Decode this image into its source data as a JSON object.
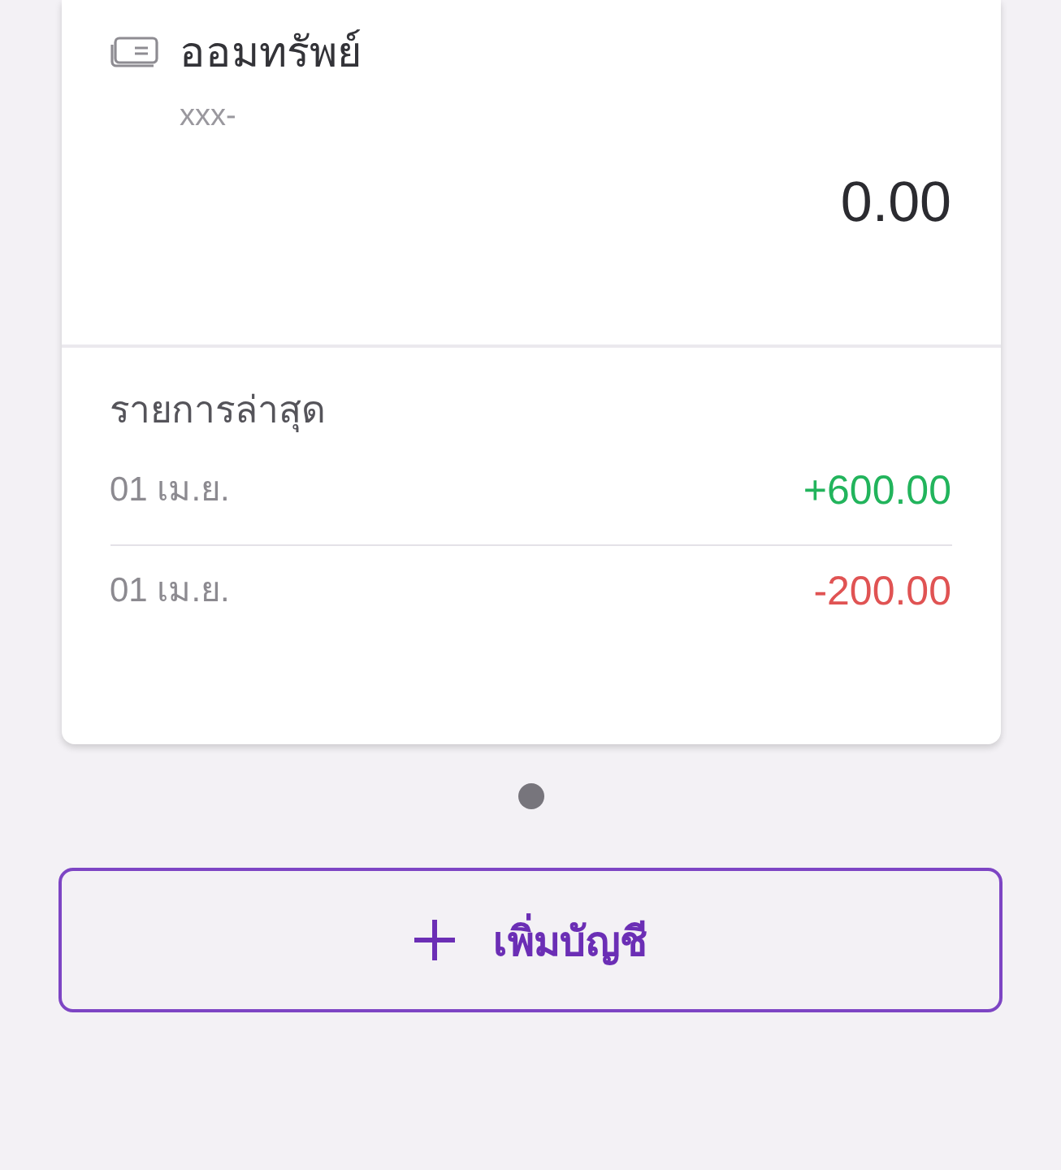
{
  "account": {
    "name": "ออมทรัพย์",
    "number": "xxx-",
    "balance": "0.00"
  },
  "recent": {
    "title": "รายการล่าสุด",
    "transactions": [
      {
        "date": "01 เม.ย.",
        "amount": "+600.00",
        "color": "#22b45c"
      },
      {
        "date": "01 เม.ย.",
        "amount": "-200.00",
        "color": "#e05353"
      }
    ]
  },
  "pager": [
    {
      "selected": true
    }
  ],
  "add_button": {
    "label": "เพิ่มบัญชี"
  }
}
